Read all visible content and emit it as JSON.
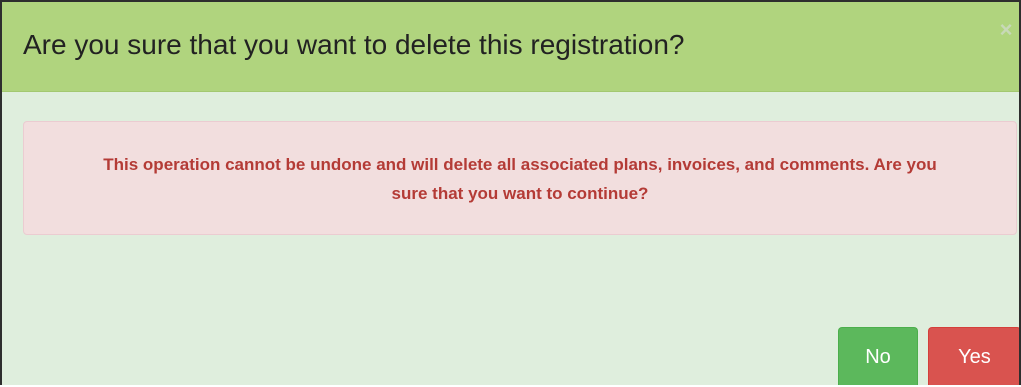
{
  "dialog": {
    "title": "Are you sure that you want to delete this registration?",
    "close_symbol": "×",
    "alert_message": "This operation cannot be undone and will delete all associated plans, invoices, and comments. Are you sure that you want to continue?",
    "no_label": "No",
    "yes_label": "Yes"
  },
  "colors": {
    "header_bg": "#b0d47e",
    "body_bg": "#dfeedd",
    "alert_bg": "#f2dede",
    "alert_text": "#b43b36",
    "no_button": "#5cb85c",
    "yes_button": "#d9534f"
  }
}
